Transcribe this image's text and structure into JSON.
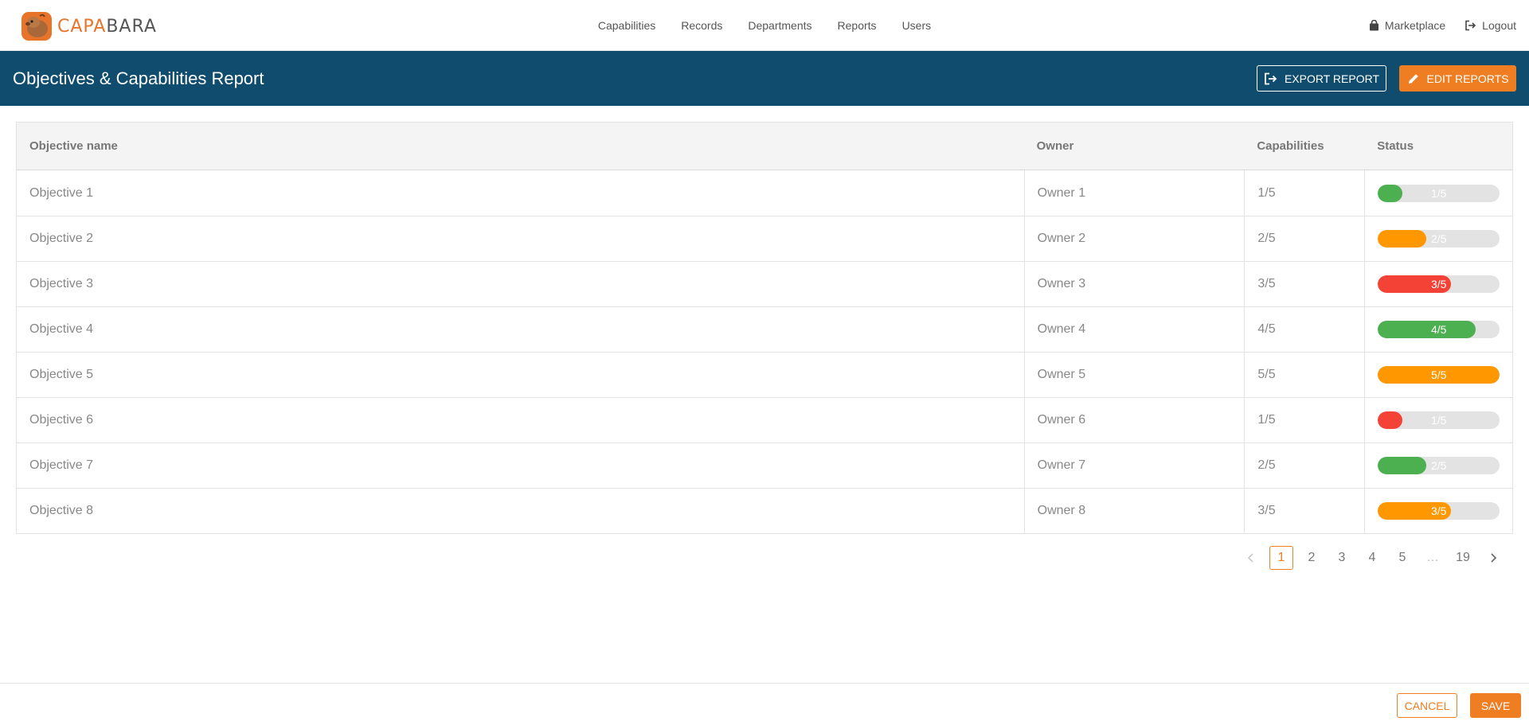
{
  "brand": {
    "name_part1": "CAPA",
    "name_part2": "BARA",
    "accent": "#e8742a",
    "icon": "capybara-logo-icon"
  },
  "nav": {
    "links": [
      "Capabilities",
      "Records",
      "Departments",
      "Reports",
      "Users"
    ],
    "marketplace": {
      "label": "Marketplace",
      "icon": "bag-icon"
    },
    "logout": {
      "label": "Logout",
      "icon": "logout-icon"
    }
  },
  "header": {
    "title": "Objectives & Capabilities Report",
    "background": "#0f4c6e",
    "export_label": "EXPORT REPORT",
    "edit_label": "EDIT REPORTS",
    "edit_color": "#ef7d22"
  },
  "table": {
    "columns": [
      "Objective name",
      "Owner",
      "Capabilities",
      "Status"
    ],
    "rows": [
      {
        "name": "Objective 1",
        "owner": "Owner 1",
        "capabilities": "1/5",
        "status": "1/5",
        "progress": 0.2,
        "color": "#4caf50"
      },
      {
        "name": "Objective 2",
        "owner": "Owner 2",
        "capabilities": "2/5",
        "status": "2/5",
        "progress": 0.4,
        "color": "#ff9800"
      },
      {
        "name": "Objective 3",
        "owner": "Owner 3",
        "capabilities": "3/5",
        "status": "3/5",
        "progress": 0.6,
        "color": "#f44336"
      },
      {
        "name": "Objective 4",
        "owner": "Owner 4",
        "capabilities": "4/5",
        "status": "4/5",
        "progress": 0.8,
        "color": "#4caf50"
      },
      {
        "name": "Objective 5",
        "owner": "Owner 5",
        "capabilities": "5/5",
        "status": "5/5",
        "progress": 1.0,
        "color": "#ff9800"
      },
      {
        "name": "Objective 6",
        "owner": "Owner 6",
        "capabilities": "1/5",
        "status": "1/5",
        "progress": 0.2,
        "color": "#f44336"
      },
      {
        "name": "Objective 7",
        "owner": "Owner 7",
        "capabilities": "2/5",
        "status": "2/5",
        "progress": 0.4,
        "color": "#4caf50"
      },
      {
        "name": "Objective 8",
        "owner": "Owner 8",
        "capabilities": "3/5",
        "status": "3/5",
        "progress": 0.6,
        "color": "#ff9800"
      }
    ]
  },
  "pagination": {
    "pages": [
      "1",
      "2",
      "3",
      "4",
      "5",
      "…",
      "19"
    ],
    "current": "1"
  },
  "footer": {
    "cancel_label": "CANCEL",
    "save_label": "SAVE"
  }
}
